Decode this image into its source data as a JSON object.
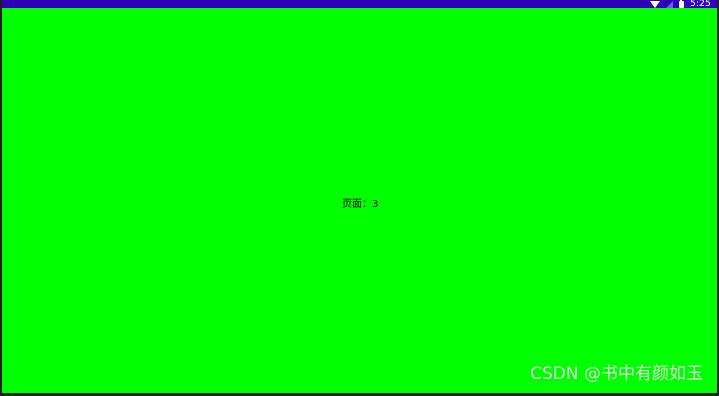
{
  "status_bar": {
    "time": "5:25",
    "icons": [
      "wifi-icon",
      "signal-icon",
      "battery-icon"
    ],
    "colors": {
      "background": "#2f00b8",
      "text": "#ffffff"
    }
  },
  "content": {
    "page_label": "页面：3",
    "background_color": "#00ff00"
  },
  "watermark": {
    "text": "CSDN @书中有颜如玉"
  }
}
